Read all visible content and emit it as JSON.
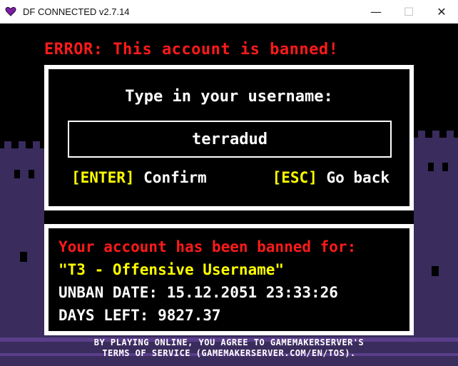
{
  "window": {
    "title": "DF CONNECTED v2.7.14",
    "controls": {
      "minimize": "—",
      "maximize": "☐",
      "close": "✕"
    }
  },
  "error": {
    "message": "ERROR: This account is banned!"
  },
  "username_panel": {
    "prompt": "Type in your username:",
    "username_value": "terradud",
    "confirm": {
      "key": "[ENTER]",
      "label": " Confirm"
    },
    "back": {
      "key": "[ESC]",
      "label": " Go back"
    }
  },
  "ban_panel": {
    "header": "Your account has been banned for:",
    "reason": "\"T3 - Offensive Username\"",
    "unban_date": "UNBAN DATE: 15.12.2051 23:33:26",
    "days_left": "DAYS LEFT: 9827.37"
  },
  "footer": {
    "tos_line1": "BY PLAYING ONLINE, YOU AGREE TO GAMEMAKERSERVER'S",
    "tos_line2": "TERMS OF SERVICE (GAMEMAKERSERVER.COM/EN/TOS)."
  },
  "colors": {
    "error_red": "#ff1a1a",
    "highlight_yellow": "#ffff00",
    "panel_border": "#ffffff",
    "silhouette_purple": "#3a2c5c",
    "app_icon": "#7a1fa2"
  },
  "icons": {
    "app_icon": "heart-icon"
  }
}
